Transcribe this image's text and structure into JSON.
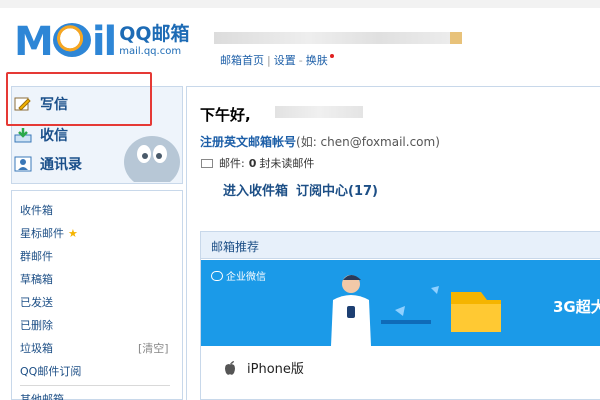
{
  "header": {
    "logo_text": "M  il",
    "logo_brand": "QQ邮箱",
    "logo_url": "mail.qq.com",
    "links": [
      "邮箱首页",
      "设置",
      "换肤"
    ],
    "separators": [
      "|",
      "-"
    ]
  },
  "sidebar": {
    "primary": [
      {
        "label": "写信",
        "icon": "pencil-icon"
      },
      {
        "label": "收信",
        "icon": "inbox-download-icon"
      },
      {
        "label": "通讯录",
        "icon": "contacts-icon"
      }
    ],
    "folders": [
      {
        "label": "收件箱"
      },
      {
        "label": "星标邮件",
        "badge": "★"
      },
      {
        "label": "群邮件"
      },
      {
        "label": "草稿箱"
      },
      {
        "label": "已发送"
      },
      {
        "label": "已删除"
      },
      {
        "label": "垃圾箱",
        "action": "[清空]"
      },
      {
        "label": "QQ邮件订阅"
      },
      {
        "label": "其他邮箱"
      }
    ]
  },
  "main": {
    "greeting": "下午好,",
    "register_link": "注册英文邮箱帐号",
    "register_hint": "(如: chen@foxmail.com)",
    "mail_label": "邮件:",
    "mail_count": "0",
    "mail_suffix": "封未读邮件",
    "inbox_link": "进入收件箱",
    "subscription_link": "订阅中心(17)",
    "recommend_title": "邮箱推荐",
    "banner_brand": "企业微信",
    "banner_text": "3G超大",
    "iphone_label": "iPhone版"
  },
  "colors": {
    "brand_blue": "#2e86d6",
    "link_blue": "#1d5fa8",
    "banner_blue": "#1b9ae8",
    "highlight_red": "#e53935"
  }
}
